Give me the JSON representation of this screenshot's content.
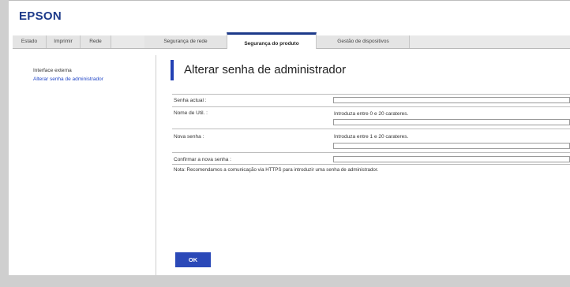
{
  "header": {
    "logo": "EPSON"
  },
  "tabs": [
    {
      "label": "Estado"
    },
    {
      "label": "Imprimir"
    },
    {
      "label": "Rede"
    },
    {
      "label": "Segurança de rede"
    },
    {
      "label": "Segurança do produto",
      "active": true
    },
    {
      "label": "Gestão de dispositivos"
    }
  ],
  "sidebar": {
    "items": [
      {
        "label": "Interface externa"
      },
      {
        "label": "Alterar senha de administrador",
        "selected": true
      }
    ]
  },
  "main": {
    "title": "Alterar senha de administrador",
    "form": {
      "current_password_label": "Senha actual :",
      "current_password_value": "",
      "username_label": "Nome de Util. :",
      "username_hint": "Introduza entre 0 e 20 carateres.",
      "username_value": "",
      "new_password_label": "Nova senha :",
      "new_password_hint": "Introduza entre 1 e 20 carateres.",
      "new_password_value": "",
      "confirm_password_label": "Confirmar a nova senha :",
      "confirm_password_value": ""
    },
    "note": "Nota: Recomendamos a comunicação via HTTPS para introduzir uma senha de administrador.",
    "ok_label": "OK"
  },
  "colors": {
    "brand": "#1d3a8a",
    "accent": "#2b49b8",
    "link": "#2146c7"
  }
}
